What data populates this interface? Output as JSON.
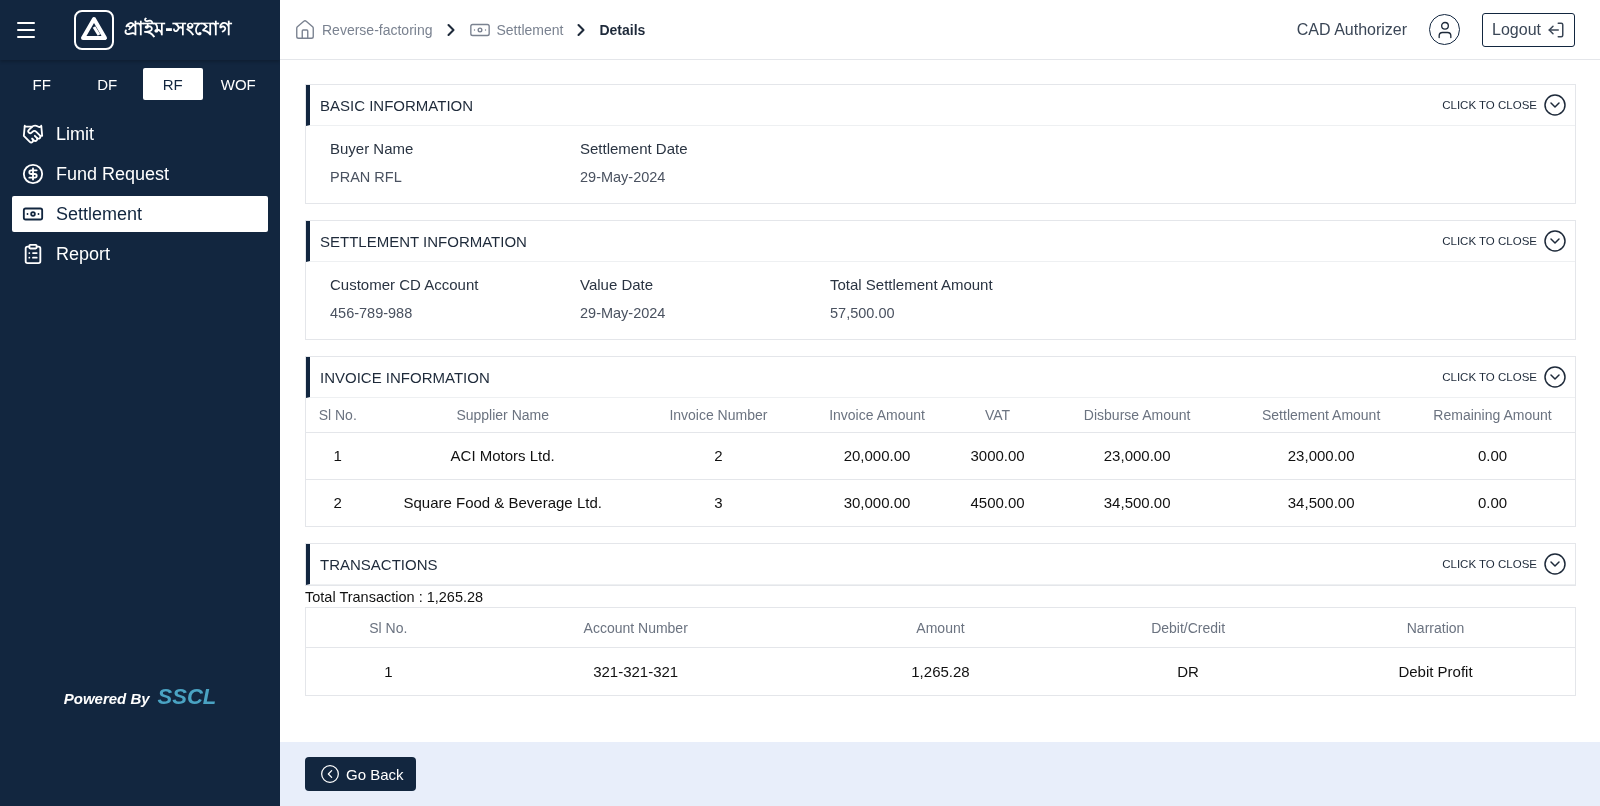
{
  "sidebar": {
    "logo_text": "প্রাইম-সংযোগ",
    "modules": [
      {
        "label": "FF",
        "selected": false
      },
      {
        "label": "DF",
        "selected": false
      },
      {
        "label": "RF",
        "selected": true
      },
      {
        "label": "WOF",
        "selected": false
      }
    ],
    "menu": [
      {
        "label": "Limit",
        "selected": false
      },
      {
        "label": "Fund Request",
        "selected": false
      },
      {
        "label": "Settlement",
        "selected": true
      },
      {
        "label": "Report",
        "selected": false
      }
    ],
    "footer": {
      "powered_by": "Powered By",
      "brand": "SSCL"
    }
  },
  "breadcrumb": [
    {
      "label": "Reverse-factoring",
      "current": false
    },
    {
      "label": "Settlement",
      "current": false
    },
    {
      "label": "Details",
      "current": true
    }
  ],
  "user": {
    "role": "CAD Authorizer"
  },
  "logout": "Logout",
  "sections": [
    {
      "kind": "fields",
      "title": "BASIC INFORMATION",
      "toggle": "CLICK TO CLOSE",
      "fields": [
        {
          "label": "Buyer Name",
          "value": "PRAN RFL"
        },
        {
          "label": "Settlement Date",
          "value": "29-May-2024"
        }
      ]
    },
    {
      "kind": "fields",
      "title": "SETTLEMENT INFORMATION",
      "toggle": "CLICK TO CLOSE",
      "fields": [
        {
          "label": "Customer CD Account",
          "value": "456-789-988"
        },
        {
          "label": "Value Date",
          "value": "29-May-2024"
        },
        {
          "label": "Total Settlement Amount",
          "value": "57,500.00"
        }
      ]
    },
    {
      "kind": "table",
      "title": "INVOICE INFORMATION",
      "toggle": "CLICK TO CLOSE",
      "columns": [
        "Sl No.",
        "Supplier Name",
        "Invoice Number",
        "Invoice Amount",
        "VAT",
        "Disburse Amount",
        "Settlement Amount",
        "Remaining Amount"
      ],
      "rows": [
        [
          "1",
          "ACI Motors Ltd.",
          "2",
          "20,000.00",
          "3000.00",
          "23,000.00",
          "23,000.00",
          "0.00"
        ],
        [
          "2",
          "Square Food & Beverage Ltd.",
          "3",
          "30,000.00",
          "4500.00",
          "34,500.00",
          "34,500.00",
          "0.00"
        ]
      ]
    },
    {
      "kind": "bordered-table",
      "title": "TRANSACTIONS",
      "toggle": "CLICK TO CLOSE",
      "summary": "Total Transaction : 1,265.28",
      "columns": [
        "Sl No.",
        "Account Number",
        "Amount",
        "Debit/Credit",
        "Narration"
      ],
      "rows": [
        [
          "1",
          "321-321-321",
          "1,265.28",
          "DR",
          "Debit Profit"
        ]
      ]
    }
  ],
  "back_button": "Go Back"
}
